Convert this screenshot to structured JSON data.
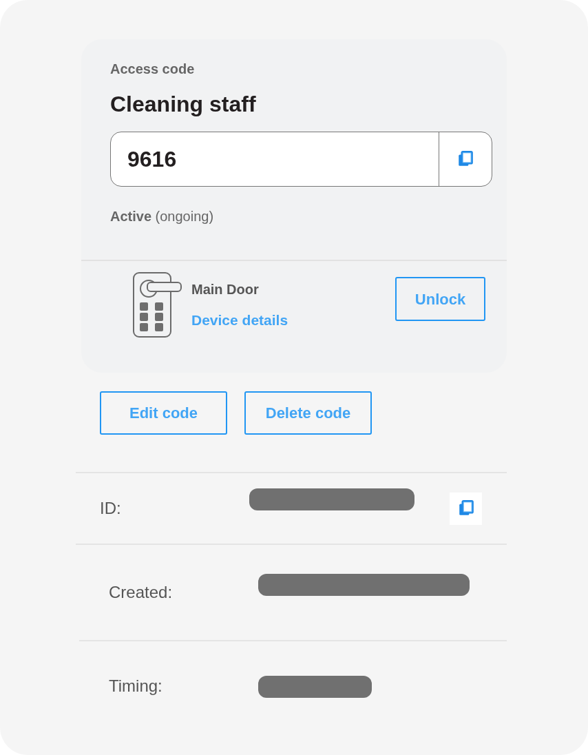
{
  "card": {
    "eyebrow": "Access code",
    "title": "Cleaning staff",
    "code": {
      "value": "9616"
    },
    "status": "**Active** (ongoing)",
    "device": {
      "name": "Main Door",
      "link": "Device details",
      "button": "Unlock"
    }
  },
  "actions": [
    "Edit code",
    "Delete code"
  ],
  "details": [
    {
      "label": "ID:",
      "copyable": true
    },
    {
      "label": "Created:",
      "copyable": false
    },
    {
      "label": "Timing:",
      "copyable": false
    }
  ]
}
